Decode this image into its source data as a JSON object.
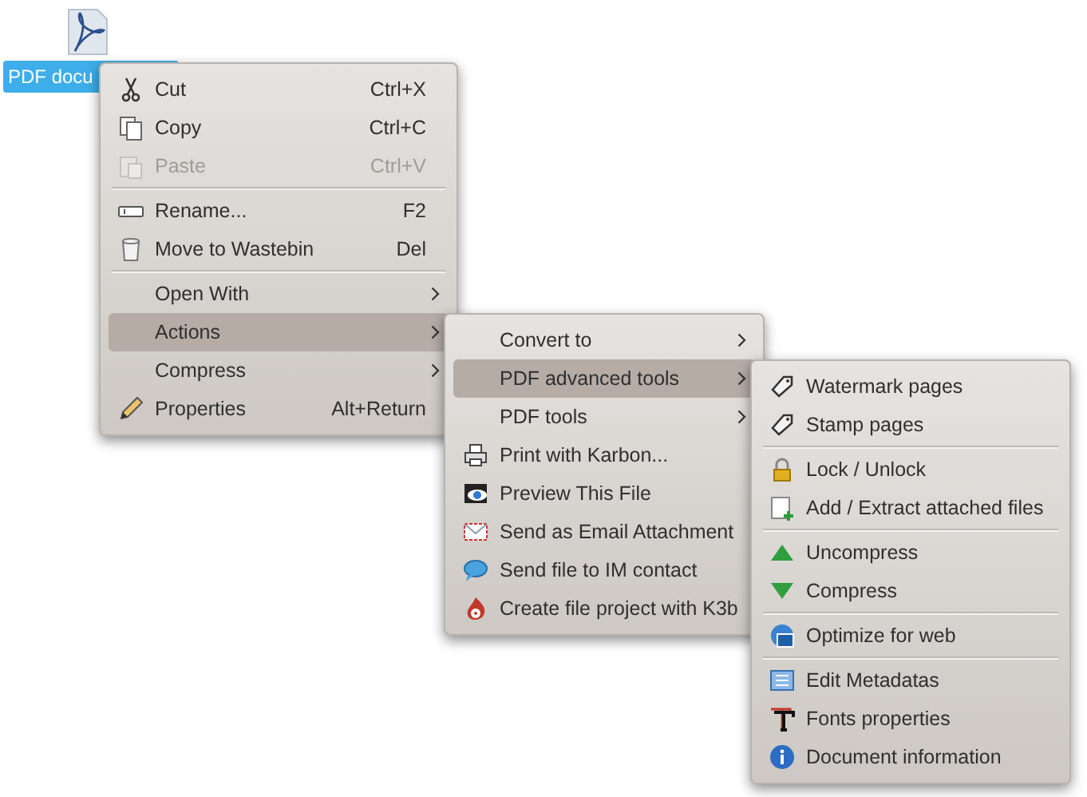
{
  "desktop_icon": {
    "label": "PDF docu",
    "selected": true
  },
  "menus": [
    {
      "items": [
        {
          "kind": "item",
          "label": "Cut",
          "shortcut": "Ctrl+X",
          "submenu": false,
          "disabled": false,
          "selected": false
        },
        {
          "kind": "item",
          "label": "Copy",
          "shortcut": "Ctrl+C",
          "submenu": false,
          "disabled": false,
          "selected": false
        },
        {
          "kind": "item",
          "label": "Paste",
          "shortcut": "Ctrl+V",
          "submenu": false,
          "disabled": true,
          "selected": false
        },
        {
          "kind": "separator"
        },
        {
          "kind": "item",
          "label": "Rename...",
          "shortcut": "F2",
          "submenu": false,
          "disabled": false,
          "selected": false
        },
        {
          "kind": "item",
          "label": "Move to Wastebin",
          "shortcut": "Del",
          "submenu": false,
          "disabled": false,
          "selected": false
        },
        {
          "kind": "separator"
        },
        {
          "kind": "item",
          "label": "Open With",
          "submenu": true,
          "disabled": false,
          "selected": false
        },
        {
          "kind": "item",
          "label": "Actions",
          "submenu": true,
          "disabled": false,
          "selected": true
        },
        {
          "kind": "item",
          "label": "Compress",
          "submenu": true,
          "disabled": false,
          "selected": false
        },
        {
          "kind": "item",
          "label": "Properties",
          "shortcut": "Alt+Return",
          "submenu": false,
          "disabled": false,
          "selected": false
        }
      ]
    },
    {
      "items": [
        {
          "kind": "item",
          "label": "Convert to",
          "submenu": true,
          "disabled": false,
          "selected": false
        },
        {
          "kind": "item",
          "label": "PDF advanced tools",
          "submenu": true,
          "disabled": false,
          "selected": true
        },
        {
          "kind": "item",
          "label": "PDF tools",
          "submenu": true,
          "disabled": false,
          "selected": false
        },
        {
          "kind": "item",
          "label": "Print with Karbon...",
          "submenu": false,
          "disabled": false,
          "selected": false
        },
        {
          "kind": "item",
          "label": "Preview This File",
          "submenu": false,
          "disabled": false,
          "selected": false
        },
        {
          "kind": "item",
          "label": "Send as Email Attachment",
          "submenu": false,
          "disabled": false,
          "selected": false
        },
        {
          "kind": "item",
          "label": "Send file to IM contact",
          "submenu": false,
          "disabled": false,
          "selected": false
        },
        {
          "kind": "item",
          "label": "Create file project with K3b",
          "submenu": false,
          "disabled": false,
          "selected": false
        }
      ]
    },
    {
      "items": [
        {
          "kind": "item",
          "label": "Watermark pages",
          "submenu": false,
          "disabled": false,
          "selected": false
        },
        {
          "kind": "item",
          "label": "Stamp pages",
          "submenu": false,
          "disabled": false,
          "selected": false
        },
        {
          "kind": "separator"
        },
        {
          "kind": "item",
          "label": "Lock / Unlock",
          "submenu": false,
          "disabled": false,
          "selected": false
        },
        {
          "kind": "item",
          "label": "Add / Extract attached files",
          "submenu": false,
          "disabled": false,
          "selected": false
        },
        {
          "kind": "separator"
        },
        {
          "kind": "item",
          "label": "Uncompress",
          "submenu": false,
          "disabled": false,
          "selected": false
        },
        {
          "kind": "item",
          "label": "Compress",
          "submenu": false,
          "disabled": false,
          "selected": false
        },
        {
          "kind": "separator"
        },
        {
          "kind": "item",
          "label": "Optimize for web",
          "submenu": false,
          "disabled": false,
          "selected": false
        },
        {
          "kind": "separator"
        },
        {
          "kind": "item",
          "label": "Edit Metadatas",
          "submenu": false,
          "disabled": false,
          "selected": false
        },
        {
          "kind": "item",
          "label": "Fonts properties",
          "submenu": false,
          "disabled": false,
          "selected": false
        },
        {
          "kind": "item",
          "label": "Document information",
          "submenu": false,
          "disabled": false,
          "selected": false
        }
      ]
    }
  ]
}
